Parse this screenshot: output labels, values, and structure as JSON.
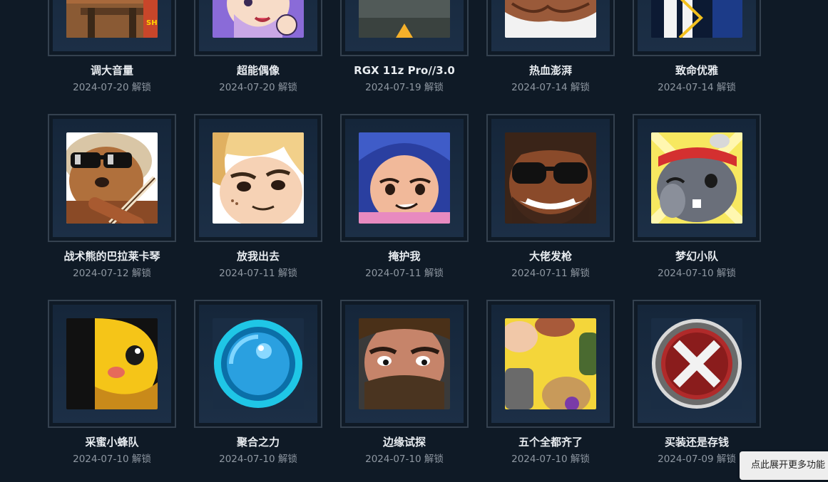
{
  "achievements": [
    {
      "id": "tiaoda",
      "name": "调大音量",
      "date": "2024-07-20",
      "unlock_label": "解锁",
      "icon": "bear-guitar-icon"
    },
    {
      "id": "chaoneng",
      "name": "超能偶像",
      "date": "2024-07-20",
      "unlock_label": "解锁",
      "icon": "idol-girl-icon"
    },
    {
      "id": "rgx",
      "name": "RGX 11z Pro//3.0",
      "date": "2024-07-19",
      "unlock_label": "解锁",
      "icon": "rgx-blaster-icon"
    },
    {
      "id": "rexue",
      "name": "热血澎湃",
      "date": "2024-07-14",
      "unlock_label": "解锁",
      "icon": "fist-bump-icon"
    },
    {
      "id": "zhiming",
      "name": "致命优雅",
      "date": "2024-07-14",
      "unlock_label": "解锁",
      "icon": "elegant-agent-icon"
    },
    {
      "id": "zhanshu",
      "name": "战术熊的巴拉莱卡琴",
      "date": "2024-07-12",
      "unlock_label": "解锁",
      "icon": "tactical-bear-balalaika-icon"
    },
    {
      "id": "fangwo",
      "name": "放我出去",
      "date": "2024-07-11",
      "unlock_label": "解锁",
      "icon": "blonde-agent-icon"
    },
    {
      "id": "yanhu",
      "name": "掩护我",
      "date": "2024-07-11",
      "unlock_label": "解锁",
      "icon": "blue-hair-girl-icon"
    },
    {
      "id": "dalao",
      "name": "大佬发枪",
      "date": "2024-07-11",
      "unlock_label": "解锁",
      "icon": "sunglasses-man-icon"
    },
    {
      "id": "menghuan",
      "name": "梦幻小队",
      "date": "2024-07-10",
      "unlock_label": "解锁",
      "icon": "bandana-rabbit-icon"
    },
    {
      "id": "caimi",
      "name": "采蜜小蜂队",
      "date": "2024-07-10",
      "unlock_label": "解锁",
      "icon": "yellow-bee-icon"
    },
    {
      "id": "juhe",
      "name": "聚合之力",
      "date": "2024-07-10",
      "unlock_label": "解锁",
      "icon": "blue-orb-icon"
    },
    {
      "id": "bianyuan",
      "name": "边缘试探",
      "date": "2024-07-10",
      "unlock_label": "解锁",
      "icon": "bearded-man-icon"
    },
    {
      "id": "wuge",
      "name": "五个全都齐了",
      "date": "2024-07-10",
      "unlock_label": "解锁",
      "icon": "five-fists-icon"
    },
    {
      "id": "maizhuang",
      "name": "买装还是存钱",
      "date": "2024-07-09",
      "unlock_label": "解锁",
      "icon": "red-x-icon"
    }
  ],
  "toast": {
    "label": "点此展开更多功能"
  },
  "colors": {
    "background": "#0f1a26",
    "frame_border": "#34414f",
    "title": "#e8ecf0",
    "date": "#8f98a2"
  }
}
